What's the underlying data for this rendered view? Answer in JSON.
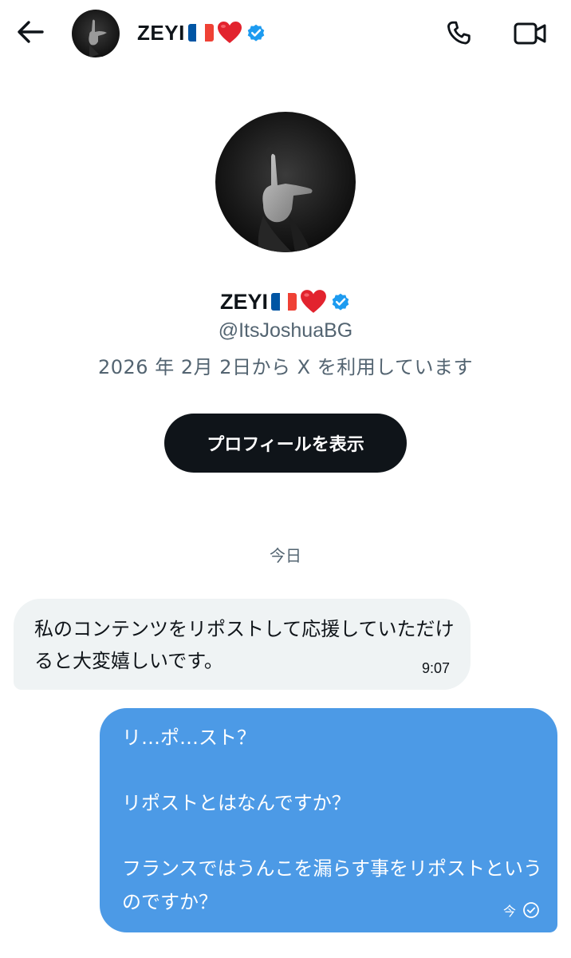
{
  "header": {
    "back_icon": "arrow-left-icon",
    "name": "ZEYI",
    "flag": "french-flag",
    "heart": "red-heart",
    "verified_icon": "verified-badge-icon",
    "call_icon": "phone-icon",
    "video_icon": "video-camera-icon"
  },
  "profile": {
    "name": "ZEYI",
    "handle": "@ItsJoshuaBG",
    "joined": "2026 年 2月 2日から X を利用しています",
    "view_profile_button": "プロフィールを表示"
  },
  "conversation": {
    "date_separator": "今日",
    "messages": [
      {
        "direction": "received",
        "text": "私のコンテンツをリポストして応援していただけると大変嬉しいです。",
        "time": "9:07"
      },
      {
        "direction": "sent",
        "paragraphs": [
          "リ…ポ…スト？",
          "リポストとはなんですか？",
          "フランスではうんこを漏らす事をリポストというのですか？"
        ],
        "time": "今",
        "status_icon": "check-circle-icon"
      }
    ]
  },
  "colors": {
    "sent_bubble": "#4c9ae6",
    "received_bubble": "#eff3f4",
    "primary_text": "#0f1419",
    "secondary_text": "#536471",
    "verified_blue": "#1d9bf0",
    "heart_red": "#e2232e"
  }
}
